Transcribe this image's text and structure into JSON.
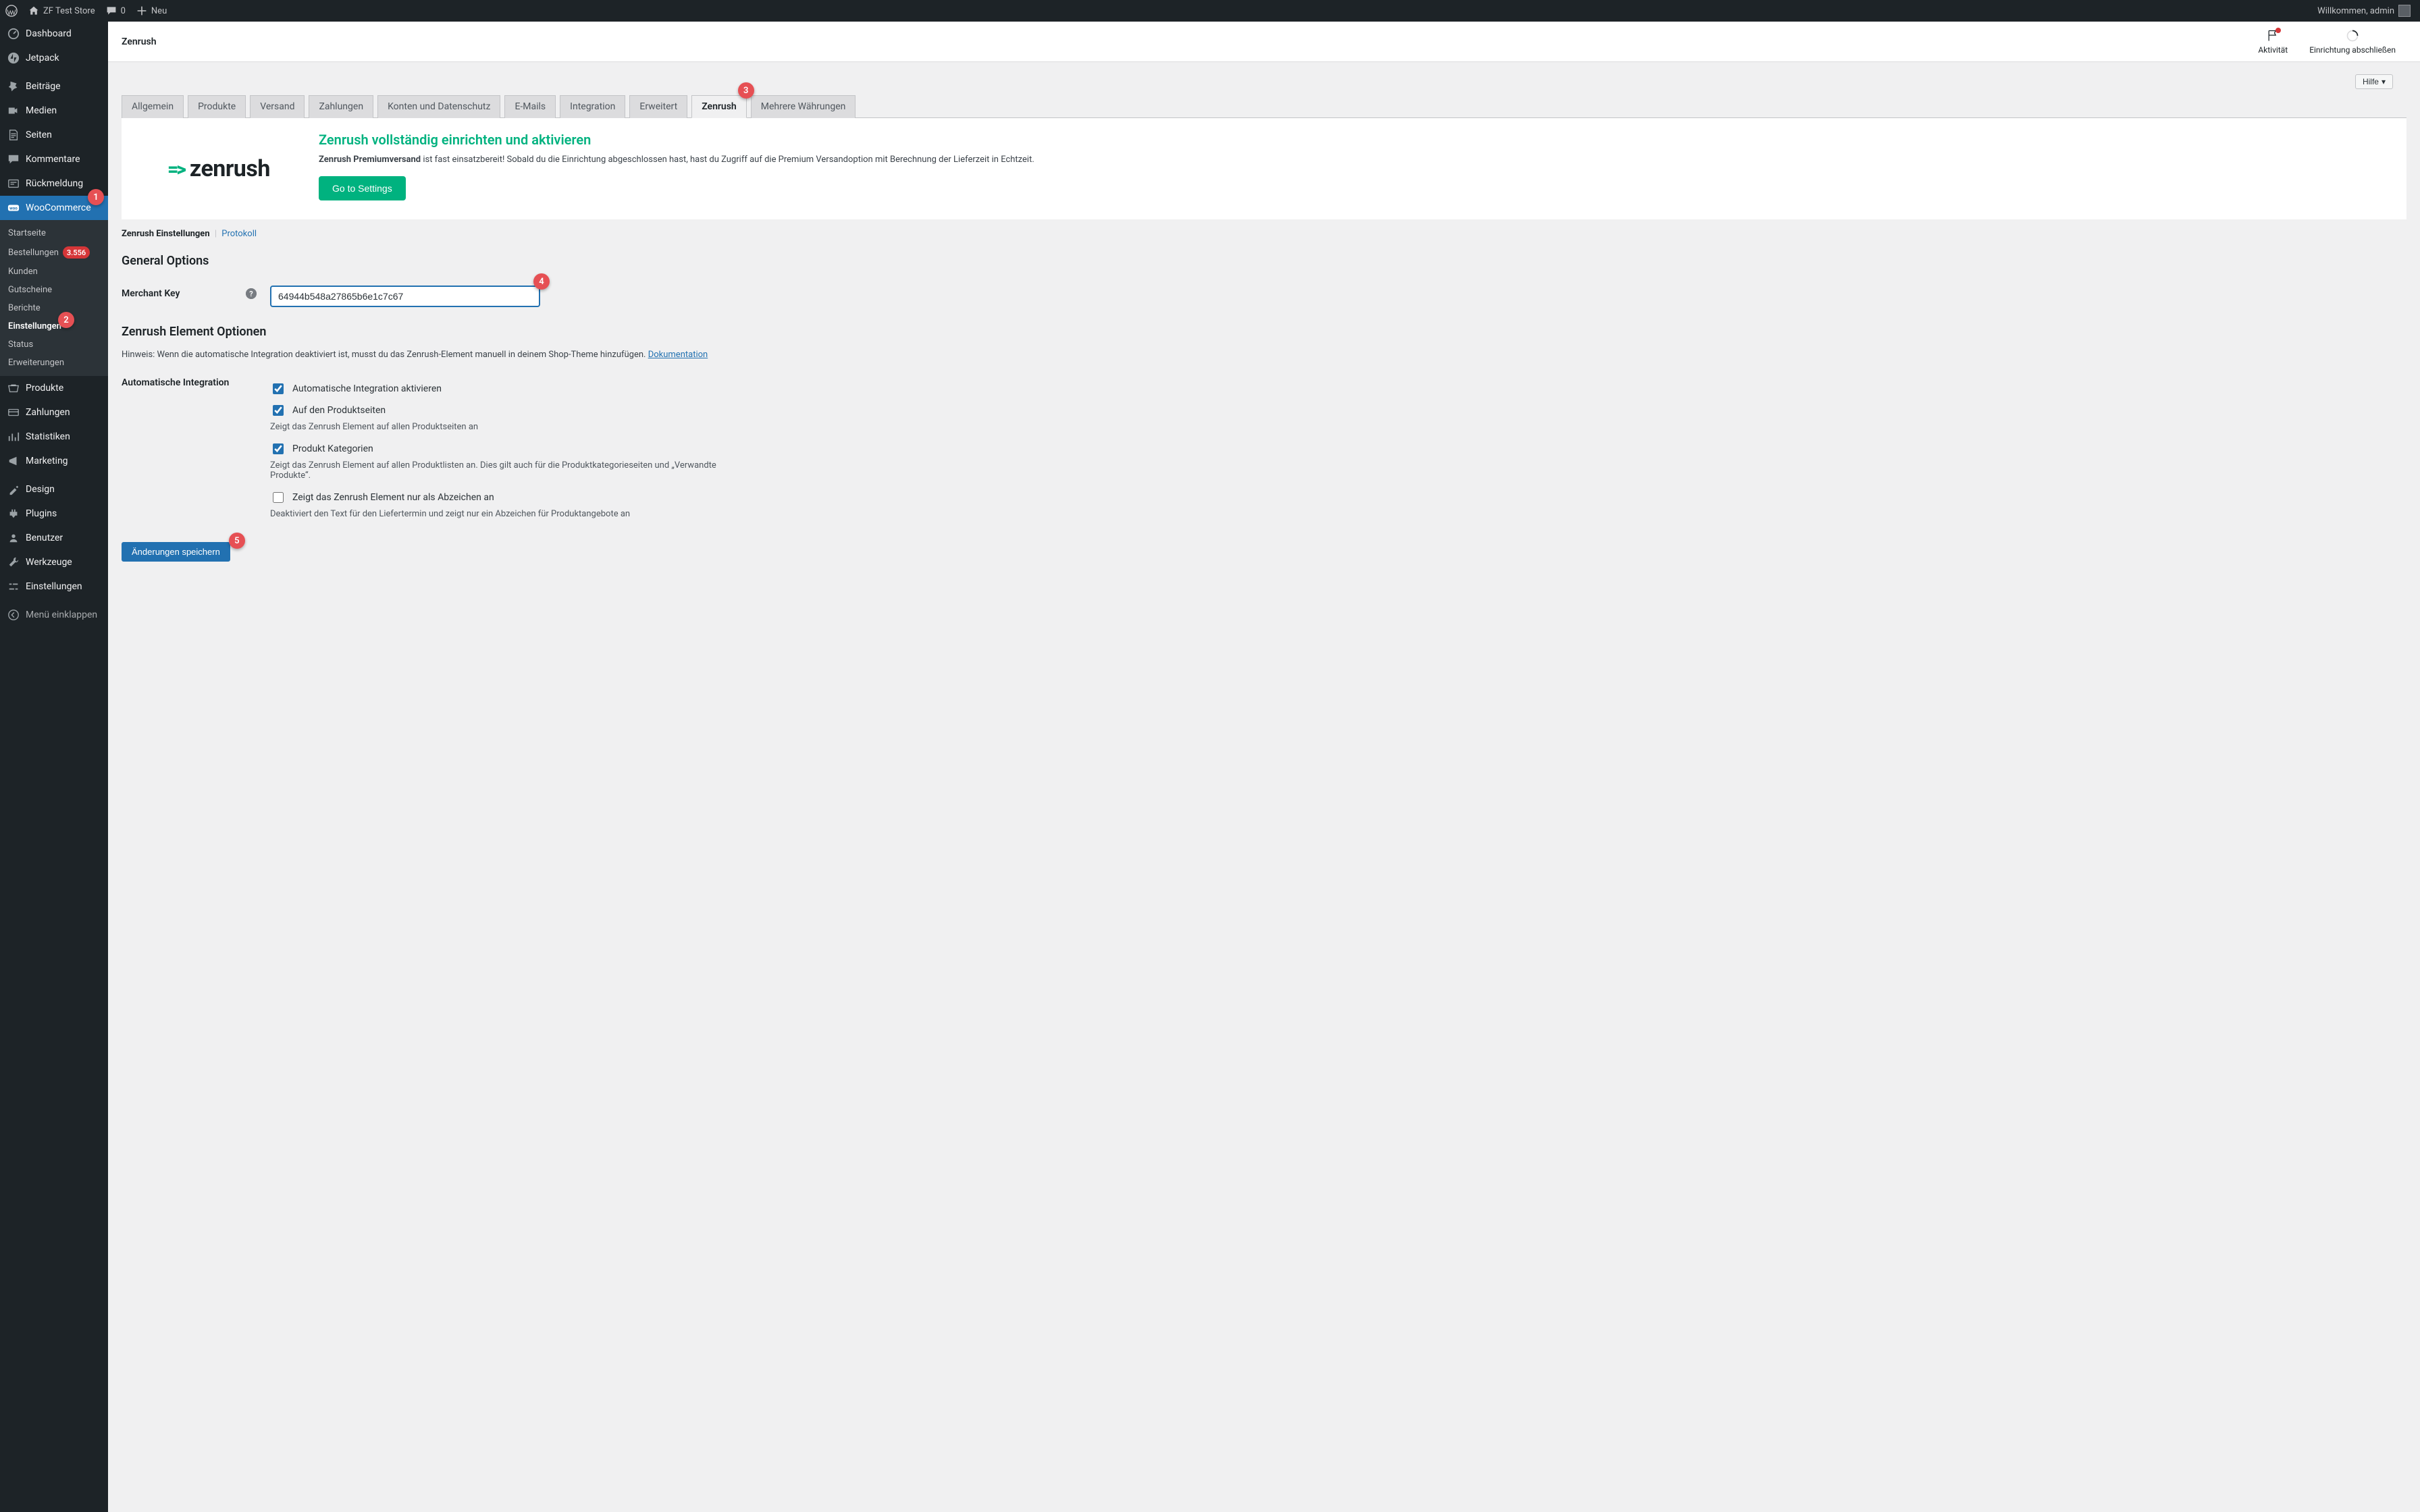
{
  "toolbar": {
    "site_name": "ZF Test Store",
    "comments_count": "0",
    "new_label": "Neu",
    "welcome": "Willkommen, admin"
  },
  "sidebar": {
    "items": [
      {
        "label": "Dashboard",
        "icon": "dashboard"
      },
      {
        "label": "Jetpack",
        "icon": "jetpack"
      },
      {
        "label": "Beiträge",
        "icon": "pin"
      },
      {
        "label": "Medien",
        "icon": "media"
      },
      {
        "label": "Seiten",
        "icon": "pages"
      },
      {
        "label": "Kommentare",
        "icon": "comment"
      },
      {
        "label": "Rückmeldung",
        "icon": "feedback"
      },
      {
        "label": "WooCommerce",
        "icon": "woo",
        "active": true
      },
      {
        "label": "Produkte",
        "icon": "products"
      },
      {
        "label": "Zahlungen",
        "icon": "payments"
      },
      {
        "label": "Statistiken",
        "icon": "stats"
      },
      {
        "label": "Marketing",
        "icon": "marketing"
      },
      {
        "label": "Design",
        "icon": "design"
      },
      {
        "label": "Plugins",
        "icon": "plugins"
      },
      {
        "label": "Benutzer",
        "icon": "users"
      },
      {
        "label": "Werkzeuge",
        "icon": "tools"
      },
      {
        "label": "Einstellungen",
        "icon": "settings"
      },
      {
        "label": "Menü einklappen",
        "icon": "collapse"
      }
    ],
    "woo_submenu": [
      {
        "label": "Startseite"
      },
      {
        "label": "Bestellungen",
        "badge": "3.556"
      },
      {
        "label": "Kunden"
      },
      {
        "label": "Gutscheine"
      },
      {
        "label": "Berichte"
      },
      {
        "label": "Einstellungen",
        "current": true
      },
      {
        "label": "Status"
      },
      {
        "label": "Erweiterungen"
      }
    ]
  },
  "header": {
    "title": "Zenrush",
    "activity": "Aktivität",
    "finish_setup": "Einrichtung abschließen",
    "help_label": "Hilfe"
  },
  "tabs": [
    {
      "label": "Allgemein"
    },
    {
      "label": "Produkte"
    },
    {
      "label": "Versand"
    },
    {
      "label": "Zahlungen"
    },
    {
      "label": "Konten und Datenschutz"
    },
    {
      "label": "E-Mails"
    },
    {
      "label": "Integration"
    },
    {
      "label": "Erweitert"
    },
    {
      "label": "Zenrush",
      "active": true
    },
    {
      "label": "Mehrere Währungen"
    }
  ],
  "banner": {
    "logo_text": "zenrush",
    "heading": "Zenrush vollständig einrichten und aktivieren",
    "lead_bold": "Zenrush Premiumversand",
    "lead_rest": " ist fast einsatzbereit! Sobald du die Einrichtung abgeschlossen hast, hast du Zugriff auf die Premium Versandoption mit Berechnung der Lieferzeit in Echtzeit.",
    "cta": "Go to Settings"
  },
  "subnav": {
    "active": "Zenrush Einstellungen",
    "link": "Protokoll"
  },
  "sections": {
    "general": "General Options",
    "elements": "Zenrush Element Optionen"
  },
  "form": {
    "merchant_key_label": "Merchant Key",
    "merchant_key_value": "64944b548a27865b6e1c7c67",
    "elements_hint_prefix": "Hinweis: Wenn die automatische Integration deaktiviert ist, musst du das Zenrush-Element manuell in deinem Shop-Theme hinzufügen. ",
    "elements_hint_link": "Dokumentation",
    "auto_label": "Automatische Integration",
    "cb_enable": "Automatische Integration aktivieren",
    "cb_product": "Auf den Produktseiten",
    "cb_product_desc": "Zeigt das Zenrush Element auf allen Produktseiten an",
    "cb_category": "Produkt Kategorien",
    "cb_category_desc": "Zeigt das Zenrush Element auf allen Produktlisten an. Dies gilt auch für die Produktkategorieseiten und „Verwandte Produkte“.",
    "cb_badge": "Zeigt das Zenrush Element nur als Abzeichen an",
    "cb_badge_desc": "Deaktiviert den Text für den Liefertermin und zeigt nur ein Abzeichen für Produktangebote an",
    "save": "Änderungen speichern"
  },
  "annotations": {
    "a1": "1",
    "a2": "2",
    "a3": "3",
    "a4": "4",
    "a5": "5"
  }
}
